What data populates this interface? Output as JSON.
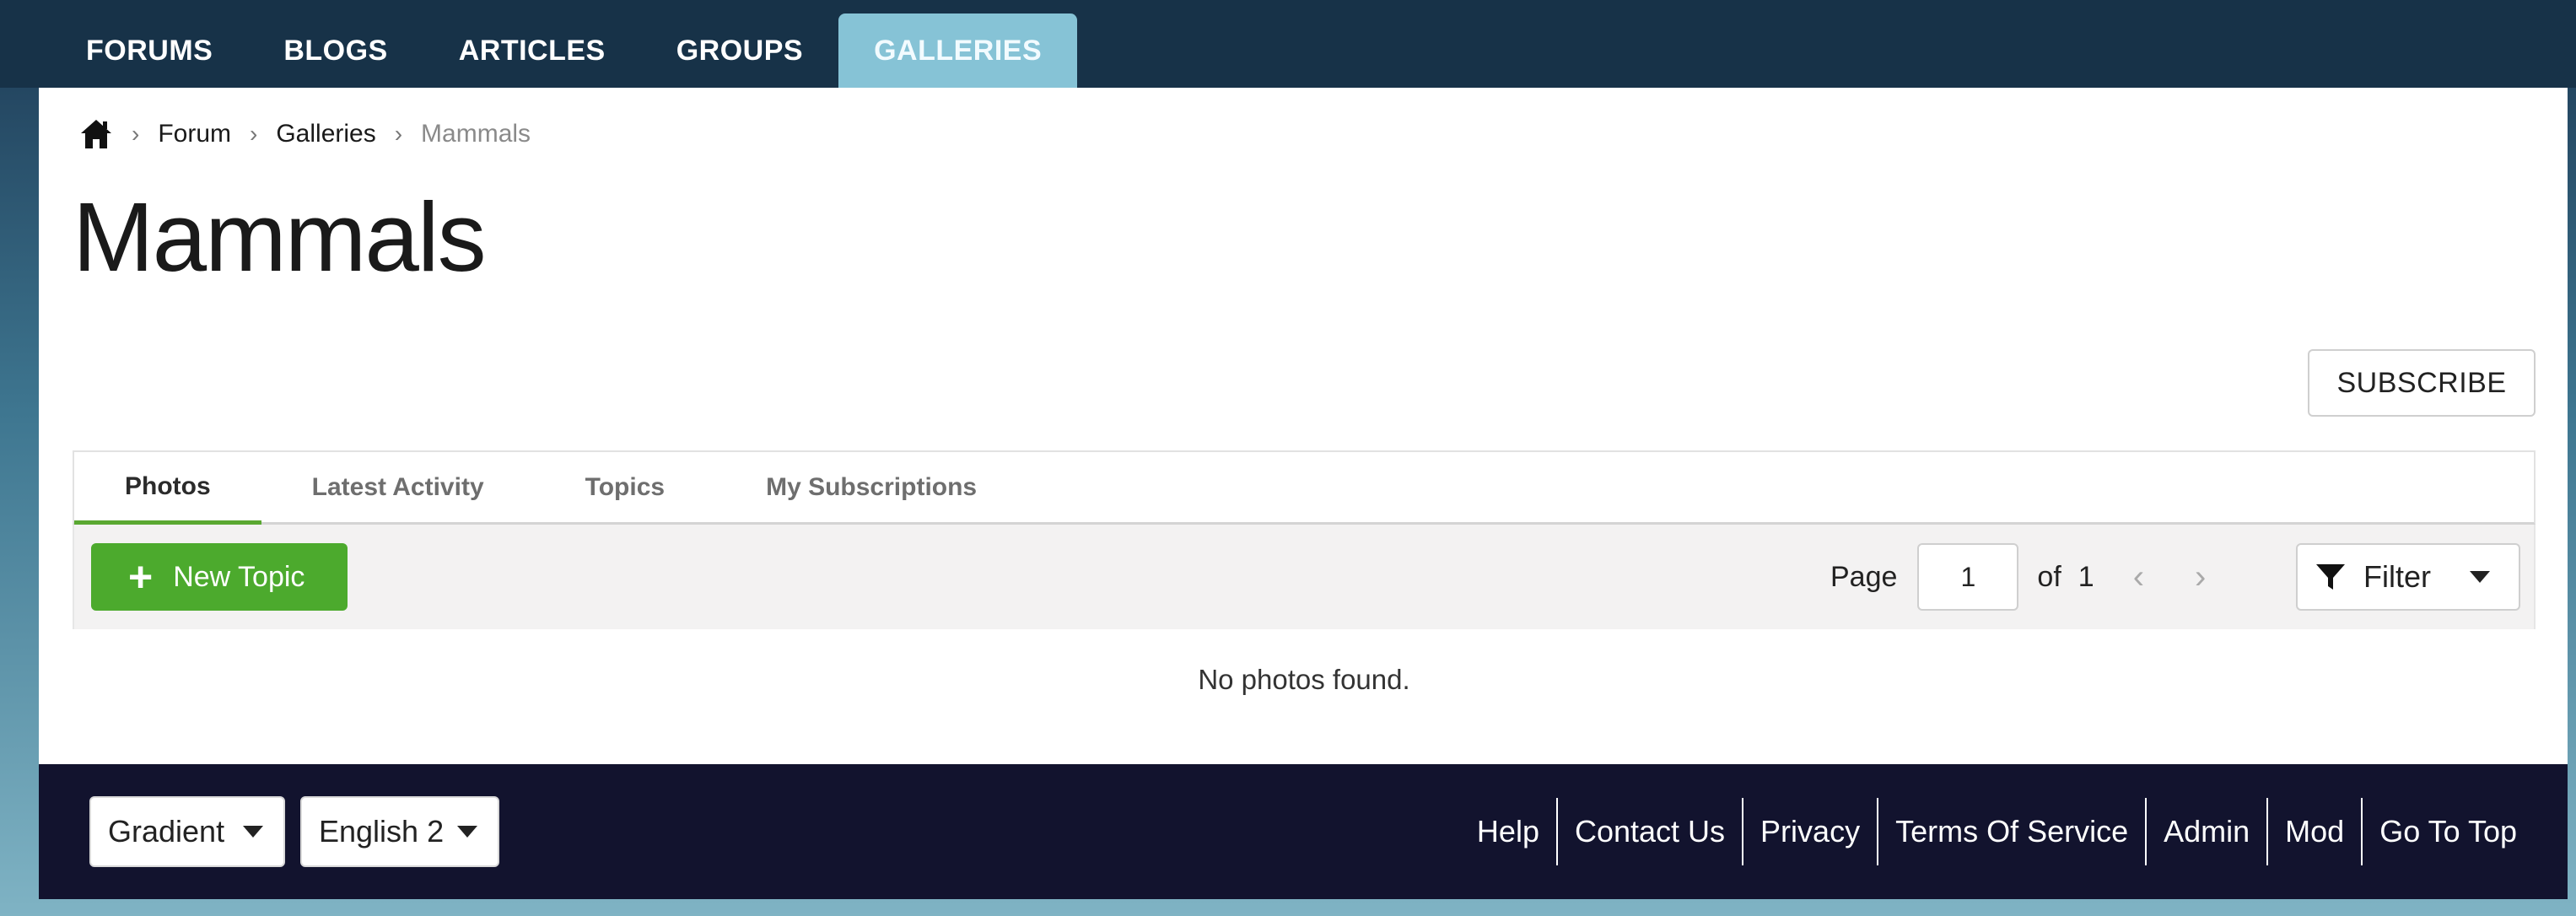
{
  "nav": {
    "tabs": [
      {
        "label": "FORUMS"
      },
      {
        "label": "BLOGS"
      },
      {
        "label": "ARTICLES"
      },
      {
        "label": "GROUPS"
      },
      {
        "label": "GALLERIES",
        "active": true
      }
    ]
  },
  "breadcrumb": {
    "home_icon": "home-icon",
    "items": [
      "Forum",
      "Galleries",
      "Mammals"
    ]
  },
  "page": {
    "title": "Mammals",
    "subscribe_label": "SUBSCRIBE"
  },
  "tabs": [
    {
      "label": "Photos",
      "active": true
    },
    {
      "label": "Latest Activity"
    },
    {
      "label": "Topics"
    },
    {
      "label": "My Subscriptions"
    }
  ],
  "toolbar": {
    "new_topic_label": "New Topic",
    "page_label": "Page",
    "page_value": "1",
    "of_label": "of",
    "total_pages": "1",
    "filter_label": "Filter"
  },
  "content": {
    "empty_message": "No photos found."
  },
  "footer": {
    "theme_select": "Gradient",
    "language_select": "English 2",
    "links": [
      "Help",
      "Contact Us",
      "Privacy",
      "Terms Of Service",
      "Admin",
      "Mod",
      "Go To Top"
    ]
  },
  "colors": {
    "nav_bg": "#173248",
    "active_tab": "#86c3d6",
    "accent_green": "#4caa2d",
    "footer_bg": "#12132e"
  }
}
